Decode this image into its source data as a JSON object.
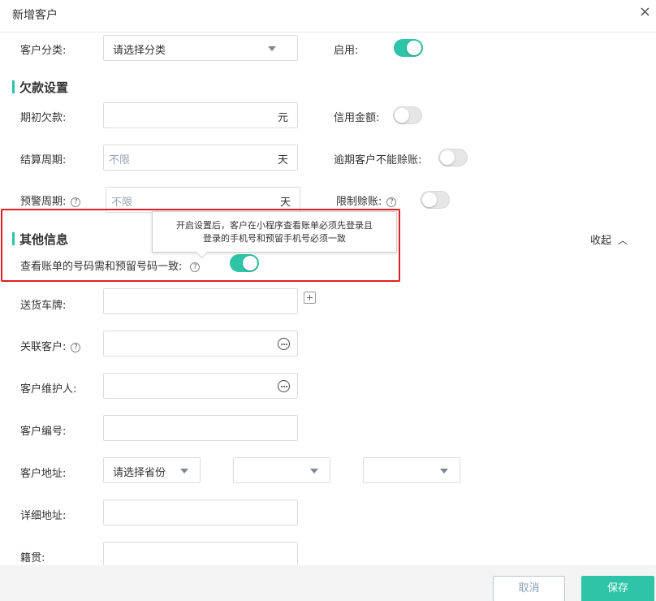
{
  "dialog": {
    "title": "新增客户",
    "close_icon": "×"
  },
  "category": {
    "label": "客户分类:",
    "placeholder": "请选择分类"
  },
  "enabled": {
    "label": "启用:",
    "on": true
  },
  "debt_section": {
    "title": "欠款设置"
  },
  "initial_debt": {
    "label": "期初欠款:",
    "suffix": "元"
  },
  "credit_amount": {
    "label": "信用金额:",
    "on": false
  },
  "settle_period": {
    "label": "结算周期:",
    "value": "不限",
    "suffix": "天"
  },
  "overdue_no_credit": {
    "label": "逾期客户不能赊账:",
    "on": false
  },
  "warn_period": {
    "label": "预警周期:",
    "value": "不限",
    "suffix": "天"
  },
  "limit_credit": {
    "label": "限制赊账:",
    "on": false
  },
  "other_section": {
    "title": "其他信息",
    "collapse_label": "收起",
    "collapse_icon": "chevron-up"
  },
  "tooltip": {
    "line1": "开启设置后，客户在小程序查看账单必须先登录且",
    "line2": "登录的手机号和预留手机号必须一致"
  },
  "phone_match": {
    "label": "查看账单的号码需和预留号码一致:",
    "on": true
  },
  "plate": {
    "label": "送货车牌:"
  },
  "related_customer": {
    "label": "关联客户:"
  },
  "maintainer": {
    "label": "客户维护人:"
  },
  "customer_no": {
    "label": "客户编号:"
  },
  "address": {
    "label": "客户地址:",
    "province_placeholder": "请选择省份"
  },
  "detail_address": {
    "label": "详细地址:"
  },
  "origin": {
    "label": "籍贯:"
  },
  "footer": {
    "cancel": "取消",
    "save": "保存"
  },
  "colors": {
    "accent": "#2ec4a8",
    "highlight_border": "#e11f1f"
  }
}
